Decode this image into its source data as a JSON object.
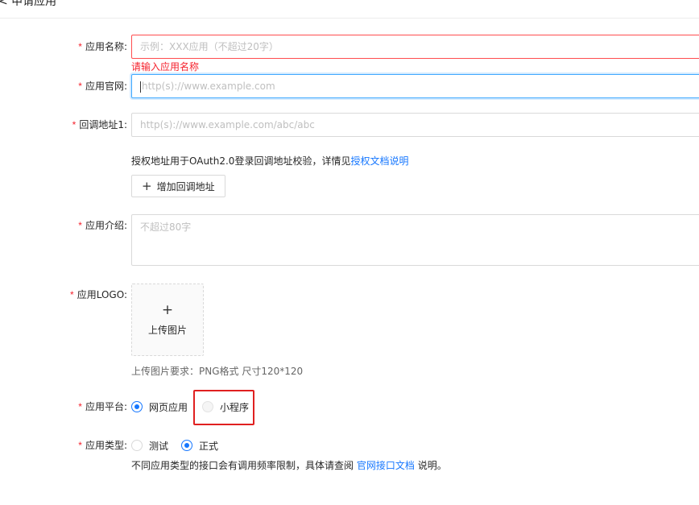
{
  "header": {
    "title": "< 申请应用"
  },
  "required_mark": "*",
  "form": {
    "app_name": {
      "label": "应用名称:",
      "placeholder": "示例：XXX应用（不超过20字）",
      "error": "请输入应用名称"
    },
    "website": {
      "label": "应用官网:",
      "placeholder": "http(s)://www.example.com"
    },
    "callback": {
      "label": "回调地址1:",
      "placeholder": "http(s)://www.example.com/abc/abc",
      "help_text": "授权地址用于OAuth2.0登录回调地址校验，详情见",
      "help_link": "授权文档说明",
      "add_icon": "+",
      "add_button": "增加回调地址"
    },
    "intro": {
      "label": "应用介绍:",
      "placeholder": "不超过80字"
    },
    "logo": {
      "label": "应用LOGO:",
      "upload_icon": "+",
      "upload_text": "上传图片",
      "hint": "上传图片要求：PNG格式 尺寸120*120"
    },
    "platform": {
      "label": "应用平台:",
      "options": [
        "网页应用",
        "小程序"
      ],
      "selected": "网页应用"
    },
    "type": {
      "label": "应用类型:",
      "options": [
        "测试",
        "正式"
      ],
      "selected": "正式",
      "help_prefix": "不同应用类型的接口会有调用频率限制，具体请查阅",
      "help_link": "官网接口文档",
      "help_suffix": "说明。"
    }
  },
  "colors": {
    "primary": "#1677ff",
    "error": "#f5222d",
    "highlight": "#e02020"
  }
}
